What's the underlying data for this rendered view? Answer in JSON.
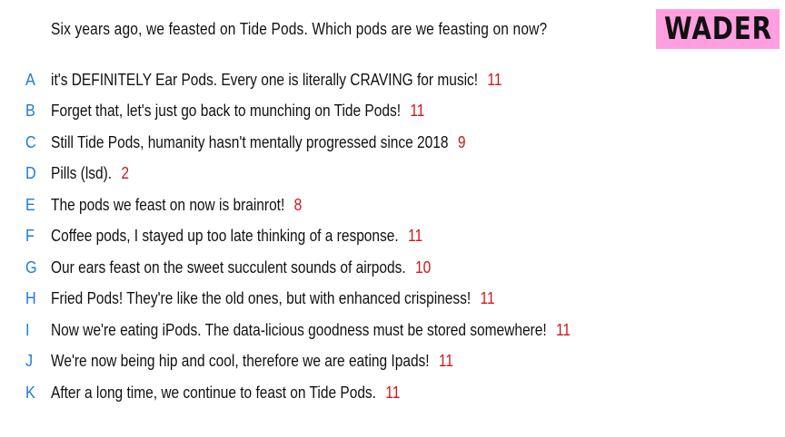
{
  "badge": {
    "name": "WADER"
  },
  "question": "Six years ago, we feasted on Tide Pods. Which pods are we feasting on now?",
  "colors": {
    "letter": "#1e7bd6",
    "score": "#d0161c",
    "badge": "#ff9fe0"
  },
  "answers": [
    {
      "letter": "A",
      "text": "it's DEFINITELY Ear Pods. Every one is literally CRAVING for music!",
      "score": "11"
    },
    {
      "letter": "B",
      "text": "Forget that, let's just go back to munching on Tide Pods!",
      "score": "11"
    },
    {
      "letter": "C",
      "text": "Still Tide Pods, humanity hasn't mentally progressed since 2018",
      "score": "9"
    },
    {
      "letter": "D",
      "text": "Pills (lsd).",
      "score": "2"
    },
    {
      "letter": "E",
      "text": "The pods we feast on now is brainrot!",
      "score": "8"
    },
    {
      "letter": "F",
      "text": "Coffee pods, I stayed up too late thinking of a response.",
      "score": "11"
    },
    {
      "letter": "G",
      "text": "Our ears feast on the sweet succulent sounds of airpods.",
      "score": "10"
    },
    {
      "letter": "H",
      "text": "Fried Pods! They're like the old ones, but with enhanced crispiness!",
      "score": "11"
    },
    {
      "letter": "I",
      "text": "Now we're eating iPods. The data-licious goodness must be stored somewhere!",
      "score": "11"
    },
    {
      "letter": "J",
      "text": "We're now being hip and cool, therefore we are eating Ipads!",
      "score": "11"
    },
    {
      "letter": "K",
      "text": "After a long time, we continue to feast on Tide Pods.",
      "score": "11"
    }
  ]
}
